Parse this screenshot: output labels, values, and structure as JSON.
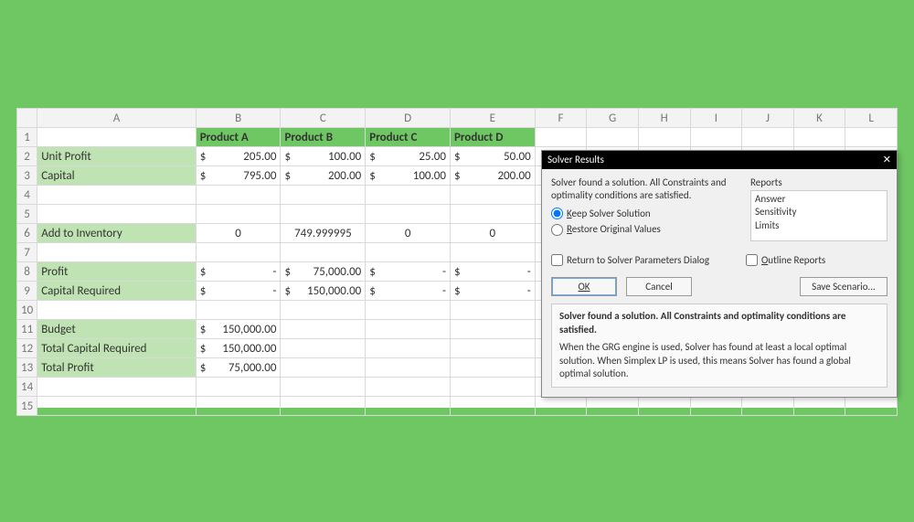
{
  "columns": [
    "A",
    "B",
    "C",
    "D",
    "E",
    "F",
    "G",
    "H",
    "I",
    "J",
    "K",
    "L"
  ],
  "rows": [
    "1",
    "2",
    "3",
    "4",
    "5",
    "6",
    "7",
    "8",
    "9",
    "10",
    "11",
    "12",
    "13",
    "14",
    "15"
  ],
  "headers": {
    "product_a": "Product A",
    "product_b": "Product B",
    "product_c": "Product C",
    "product_d": "Product D"
  },
  "labels": {
    "unit_profit": "Unit Profit",
    "capital": "Capital",
    "add_inventory": "Add to Inventory",
    "profit": "Profit",
    "capital_required": "Capital Required",
    "budget": "Budget",
    "total_capital_required": "Total Capital Required",
    "total_profit": "Total Profit"
  },
  "currency": "$",
  "dash": "-",
  "values": {
    "unit_profit": {
      "a": "205.00",
      "b": "100.00",
      "c": "25.00",
      "d": "50.00"
    },
    "capital": {
      "a": "795.00",
      "b": "200.00",
      "c": "100.00",
      "d": "200.00"
    },
    "inventory": {
      "a": "0",
      "b": "749.999995",
      "c": "0",
      "d": "0"
    },
    "profit": {
      "b": "75,000.00"
    },
    "capital_required": {
      "b": "150,000.00"
    },
    "budget": "150,000.00",
    "total_capital_required": "150,000.00",
    "total_profit": "75,000.00"
  },
  "dialog": {
    "title": "Solver Results",
    "status": "Solver found a solution.  All Constraints and optimality conditions are satisfied.",
    "keep": "Keep Solver Solution",
    "restore": "Restore Original Values",
    "reports_label": "Reports",
    "reports": [
      "Answer",
      "Sensitivity",
      "Limits"
    ],
    "return_params": "Return to Solver Parameters Dialog",
    "outline": "Outline Reports",
    "ok": "OK",
    "cancel": "Cancel",
    "save_scenario": "Save Scenario...",
    "bold_status": "Solver found a solution.  All Constraints and optimality conditions are satisfied.",
    "explain": "When the GRG engine is used, Solver has found at least a local optimal solution. When Simplex LP is used, this means Solver has found a global optimal solution."
  }
}
